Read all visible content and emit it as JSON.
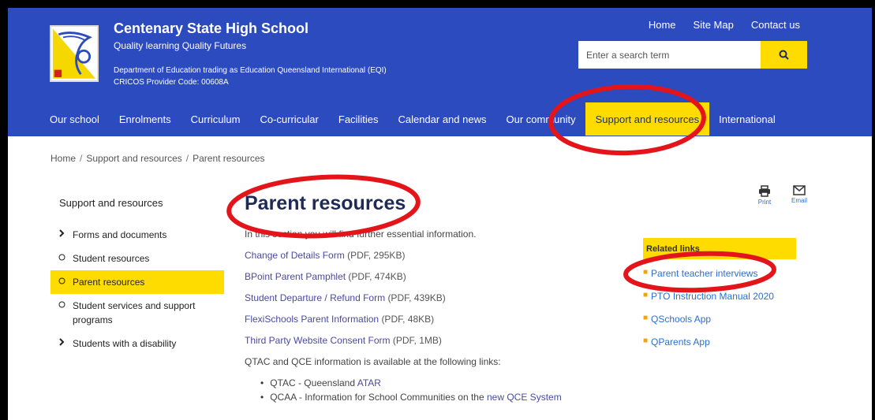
{
  "header": {
    "school_name": "Centenary State High School",
    "tagline": "Quality learning Quality Futures",
    "department": "Department of Education trading as Education Queensland International (EQI)",
    "cricos": "CRICOS Provider Code: 00608A",
    "top_links": [
      "Home",
      "Site Map",
      "Contact us"
    ],
    "search_placeholder": "Enter a search term",
    "brand_color": "#2b4bbf",
    "accent_color": "#ffdc00"
  },
  "nav": {
    "items": [
      "Our school",
      "Enrolments",
      "Curriculum",
      "Co-curricular",
      "Facilities",
      "Calendar and news",
      "Our community",
      "Support and resources",
      "International"
    ],
    "active": "Support and resources"
  },
  "breadcrumb": [
    "Home",
    "Support and resources",
    "Parent resources"
  ],
  "sidebar": {
    "title": "Support and resources",
    "items": [
      {
        "label": "Forms and documents",
        "marker": "chevron"
      },
      {
        "label": "Student resources",
        "marker": "circle"
      },
      {
        "label": "Parent resources",
        "marker": "circle",
        "active": true
      },
      {
        "label": "Student services and support programs",
        "marker": "circle"
      },
      {
        "label": "Students with a disability",
        "marker": "chevron"
      }
    ]
  },
  "main": {
    "title": "Parent resources",
    "intro": "In this section you will find further essential information.",
    "links": [
      {
        "label": "Change of Details Form",
        "meta": "(PDF, 295KB)"
      },
      {
        "label": "BPoint Parent Pamphlet",
        "meta": "(PDF, 474KB)"
      },
      {
        "label": "Student Departure / Refund Form",
        "meta": "(PDF, 439KB)"
      },
      {
        "label": "FlexiSchools Parent Information",
        "meta": "(PDF, 48KB)"
      },
      {
        "label": "Third Party Website Consent Form",
        "meta": "(PDF, 1MB)"
      }
    ],
    "qtac_text": "QTAC and QCE information is available at the following links:",
    "bullets": [
      {
        "text": "QTAC - Queensland ",
        "link": "ATAR"
      },
      {
        "text": "QCAA - Information for School Communities on the ",
        "link": "new QCE System"
      }
    ]
  },
  "tools": {
    "print": "Print",
    "email": "Email"
  },
  "related": {
    "title": "Related links",
    "items": [
      "Parent teacher interviews",
      "PTO Instruction Manual 2020",
      "QSchools App",
      "QParents App"
    ]
  }
}
